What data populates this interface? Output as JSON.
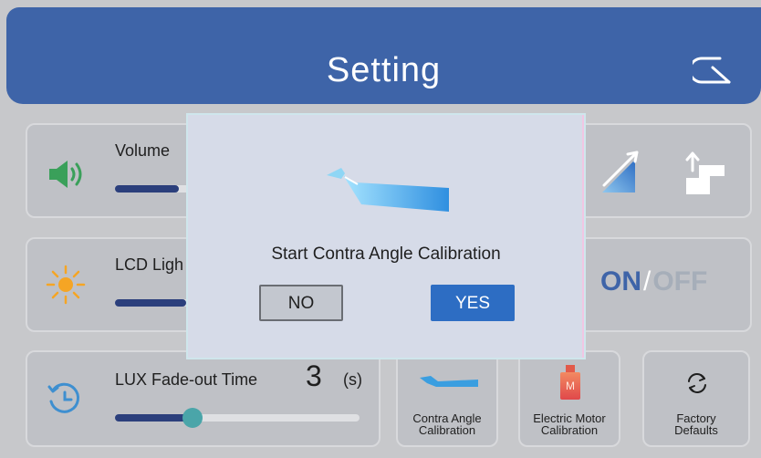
{
  "header": {
    "title": "Setting"
  },
  "panels": {
    "volume": {
      "label": "Volume",
      "level": 0.35
    },
    "lcd": {
      "label": "LCD Ligh",
      "level": 0.35
    },
    "lux": {
      "label": "LUX Fade-out Time",
      "value": "3",
      "unit": "(s)",
      "level": 0.32
    }
  },
  "toggle": {
    "on": "ON",
    "slash": "/",
    "off": "OFF"
  },
  "buttons": {
    "contra": {
      "line1": "Contra Angle",
      "line2": "Calibration"
    },
    "motor": {
      "line1": "Electric Motor",
      "line2": "Calibration",
      "badge": "M"
    },
    "factory": {
      "line1": "Factory",
      "line2": "Defaults"
    }
  },
  "dialog": {
    "message": "Start Contra Angle Calibration",
    "no_label": "NO",
    "yes_label": "YES"
  },
  "colors": {
    "header": "#3e64a8",
    "accent": "#2d6dc3",
    "knob": "#4aa5a9",
    "sun": "#f5a524",
    "speaker": "#3aa05a"
  }
}
